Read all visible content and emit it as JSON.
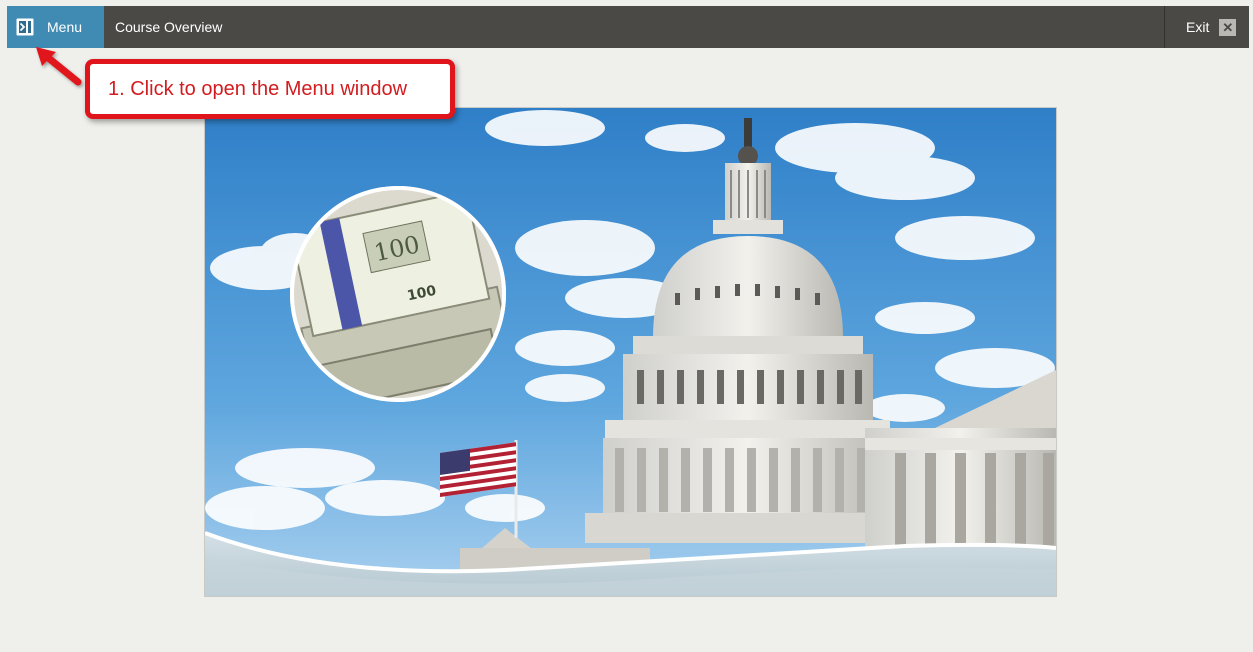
{
  "toolbar": {
    "menu_label": "Menu",
    "course_title": "Course Overview",
    "exit_label": "Exit",
    "menu_icon": "sidebar-toggle-icon",
    "exit_icon": "close-icon"
  },
  "callout": {
    "text": "1. Click to open the Menu window",
    "color": "#e0151b"
  },
  "slide": {
    "image": "capitol-building-with-money"
  },
  "colors": {
    "topbar": "#4a4946",
    "menu_accent": "#3f8bb4",
    "background": "#efefec"
  }
}
